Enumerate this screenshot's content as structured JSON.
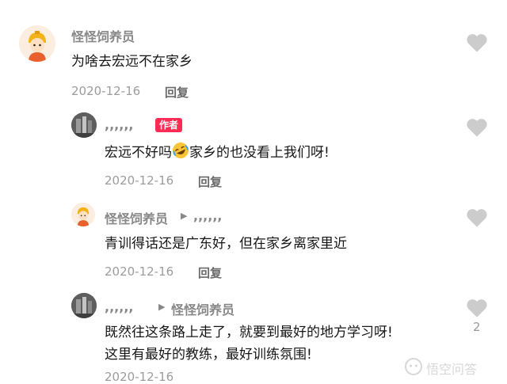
{
  "comments": [
    {
      "author": "怪怪饲养员",
      "text": "为啥去宏远不在家乡",
      "date": "2020-12-16",
      "reply_label": "回复",
      "avatar": "cartoon-avatar"
    },
    {
      "author": ",,,,,,",
      "badge": "作者",
      "text_before": "宏远不好吗",
      "emoji": "rolling-laughing-emoji",
      "text_after": "家乡的也没看上我们呀!",
      "date": "2020-12-16",
      "reply_label": "回复",
      "avatar": "photo-avatar"
    },
    {
      "author": "怪怪饲养员",
      "reply_to": ",,,,,,",
      "text": "青训得话还是广东好，但在家乡离家里近",
      "date": "2020-12-16",
      "reply_label": "回复",
      "avatar": "cartoon-avatar"
    },
    {
      "author": ",,,,,,",
      "reply_to": "怪怪饲养员",
      "text_line1": "既然往这条路上走了，就要到最好的地方学习呀!",
      "text_line2": "这里有最好的教练，最好训练氛围!",
      "date": "2020-12-16",
      "like_count": "2",
      "avatar": "photo-avatar"
    }
  ],
  "watermark": "悟空问答",
  "colors": {
    "badge": "#fe2c55",
    "heart": "#cccccc"
  }
}
